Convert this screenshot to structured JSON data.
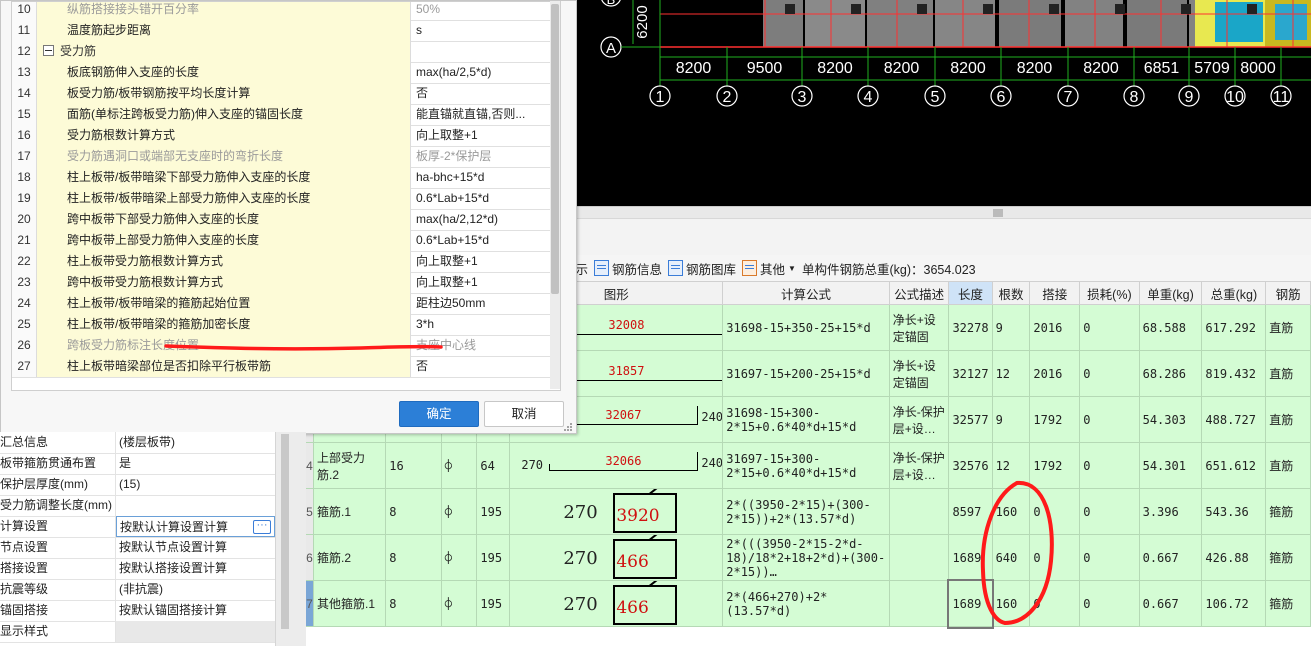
{
  "dialog": {
    "rows": [
      {
        "n": "10",
        "k": "纵筋搭接接头错开百分率",
        "v": "50%",
        "disabled": true
      },
      {
        "n": "11",
        "k": "温度筋起步距离",
        "v": "s"
      },
      {
        "n": "12",
        "k": "受力筋",
        "v": "",
        "group": true
      },
      {
        "n": "13",
        "k": "板底钢筋伸入支座的长度",
        "v": "max(ha/2,5*d)"
      },
      {
        "n": "14",
        "k": "板受力筋/板带钢筋按平均长度计算",
        "v": "否"
      },
      {
        "n": "15",
        "k": "面筋(单标注跨板受力筋)伸入支座的锚固长度",
        "v": "能直锚就直锚,否则..."
      },
      {
        "n": "16",
        "k": "受力筋根数计算方式",
        "v": "向上取整+1"
      },
      {
        "n": "17",
        "k": "受力筋遇洞口或端部无支座时的弯折长度",
        "v": "板厚-2*保护层",
        "disabled": true
      },
      {
        "n": "18",
        "k": "柱上板带/板带暗梁下部受力筋伸入支座的长度",
        "v": "ha-bhc+15*d"
      },
      {
        "n": "19",
        "k": "柱上板带/板带暗梁上部受力筋伸入支座的长度",
        "v": "0.6*Lab+15*d"
      },
      {
        "n": "20",
        "k": "跨中板带下部受力筋伸入支座的长度",
        "v": "max(ha/2,12*d)"
      },
      {
        "n": "21",
        "k": "跨中板带上部受力筋伸入支座的长度",
        "v": "0.6*Lab+15*d"
      },
      {
        "n": "22",
        "k": "柱上板带受力筋根数计算方式",
        "v": "向上取整+1"
      },
      {
        "n": "23",
        "k": "跨中板带受力筋根数计算方式",
        "v": "向上取整+1"
      },
      {
        "n": "24",
        "k": "柱上板带/板带暗梁的箍筋起始位置",
        "v": "距柱边50mm"
      },
      {
        "n": "25",
        "k": "柱上板带/板带暗梁的箍筋加密长度",
        "v": "3*h"
      },
      {
        "n": "26",
        "k": "跨板受力筋标注长度位置",
        "v": "支座中心线",
        "disabled": true
      },
      {
        "n": "27",
        "k": "柱上板带暗梁部位是否扣除平行板带筋",
        "v": "否"
      }
    ],
    "ok_label": "确定",
    "cancel_label": "取消"
  },
  "props": [
    {
      "k": "汇总信息",
      "v": "(楼层板带)"
    },
    {
      "k": "板带箍筋贯通布置",
      "v": "是"
    },
    {
      "k": "保护层厚度(mm)",
      "v": "(15)"
    },
    {
      "k": "受力筋调整长度(mm)",
      "v": ""
    },
    {
      "k": "计算设置",
      "v": "按默认计算设置计算",
      "selected": true
    },
    {
      "k": "节点设置",
      "v": "按默认节点设置计算"
    },
    {
      "k": "搭接设置",
      "v": "按默认搭接设置计算"
    },
    {
      "k": "抗震等级",
      "v": "(非抗震)"
    },
    {
      "k": "锚固搭接",
      "v": "按默认锚固搭接计算"
    },
    {
      "k": "显示样式",
      "v": ""
    }
  ],
  "cad": {
    "dims": [
      "8200",
      "9500",
      "8200",
      "8200",
      "8200",
      "8200",
      "8200",
      "6851",
      "5709",
      "8000"
    ],
    "axes": [
      "1",
      "2",
      "3",
      "4",
      "5",
      "6",
      "7",
      "8",
      "9",
      "10",
      "11"
    ],
    "axis_a": "A",
    "axis_b": "B",
    "dim_vertical": "6200"
  },
  "toolbar": {
    "rebar_display": "钢筋显示",
    "rebar_info": "钢筋信息",
    "rebar_library": "钢筋图库",
    "other": "其他",
    "total_weight_label": "单构件钢筋总重(kg)：3654.023"
  },
  "grid": {
    "headers": [
      "图形",
      "计算公式",
      "公式描述",
      "长度",
      "根数",
      "搭接",
      "损耗(%)",
      "单重(kg)",
      "总重(kg)",
      "钢筋"
    ],
    "rows": [
      {
        "n": "",
        "name": "",
        "dia": "",
        "grade": "",
        "code": "",
        "fig_type": "straight",
        "fig_val": "32008",
        "formula": "31698-15+350-25+15*d",
        "desc": "净长+设定锚固",
        "len": "32278",
        "count": "9",
        "lap": "2016",
        "loss": "0",
        "unit": "68.588",
        "total": "617.292",
        "kind": "直筋"
      },
      {
        "n": "",
        "name": "",
        "dia": "",
        "grade": "",
        "code": "",
        "fig_type": "straight",
        "fig_val": "31857",
        "formula": "31697-15+200-25+15*d",
        "desc": "净长+设定锚固",
        "len": "32127",
        "count": "12",
        "lap": "2016",
        "loss": "0",
        "unit": "68.286",
        "total": "819.432",
        "kind": "直筋"
      },
      {
        "n": "",
        "name": "",
        "dia": "",
        "grade": "",
        "code": "",
        "fig_type": "hook",
        "fig_val": "32067",
        "fig_hook": "240",
        "formula": "31698-15+300-2*15+0.6*40*d+15*d",
        "desc": "净长-保护层+设…",
        "len": "32577",
        "count": "9",
        "lap": "1792",
        "loss": "0",
        "unit": "54.303",
        "total": "488.727",
        "kind": "直筋"
      },
      {
        "n": "4",
        "name": "上部受力筋.2",
        "dia": "16",
        "grade": "⌽",
        "code": "64",
        "fig_type": "uhook",
        "fig_left": "270",
        "fig_val": "32066",
        "fig_hook": "240",
        "formula": "31697-15+300-2*15+0.6*40*d+15*d",
        "desc": "净长-保护层+设…",
        "len": "32576",
        "count": "12",
        "lap": "1792",
        "loss": "0",
        "unit": "54.301",
        "total": "651.612",
        "kind": "直筋"
      },
      {
        "n": "5",
        "name": "箍筋.1",
        "dia": "8",
        "grade": "⌽",
        "code": "195",
        "fig_type": "stirrup",
        "fig_left": "270",
        "fig_val": "3920",
        "formula": "2*((3950-2*15)+(300-2*15))+2*(13.57*d)",
        "desc": "",
        "len": "8597",
        "count": "160",
        "lap": "0",
        "loss": "0",
        "unit": "3.396",
        "total": "543.36",
        "kind": "箍筋"
      },
      {
        "n": "6",
        "name": "箍筋.2",
        "dia": "8",
        "grade": "⌽",
        "code": "195",
        "fig_type": "stirrup",
        "fig_left": "270",
        "fig_val": "466",
        "formula": "2*(((3950-2*15-2*d-18)/18*2+18+2*d)+(300-2*15))…",
        "desc": "",
        "len": "1689",
        "count": "640",
        "lap": "0",
        "loss": "0",
        "unit": "0.667",
        "total": "426.88",
        "kind": "箍筋"
      },
      {
        "n": "7",
        "name": "其他箍筋.1",
        "dia": "8",
        "grade": "⌽",
        "code": "195",
        "fig_type": "stirrup",
        "fig_left": "270",
        "fig_val": "466",
        "formula": "2*(466+270)+2*(13.57*d)",
        "desc": "",
        "len": "1689",
        "count": "160",
        "lap": "0",
        "loss": "0",
        "unit": "0.667",
        "total": "106.72",
        "kind": "箍筋"
      }
    ]
  },
  "colors": {
    "accent": "#2c7fd7",
    "row_green": "#d4fcd4",
    "annotation_red": "#ff1a1a",
    "cad_bg": "#000000"
  }
}
